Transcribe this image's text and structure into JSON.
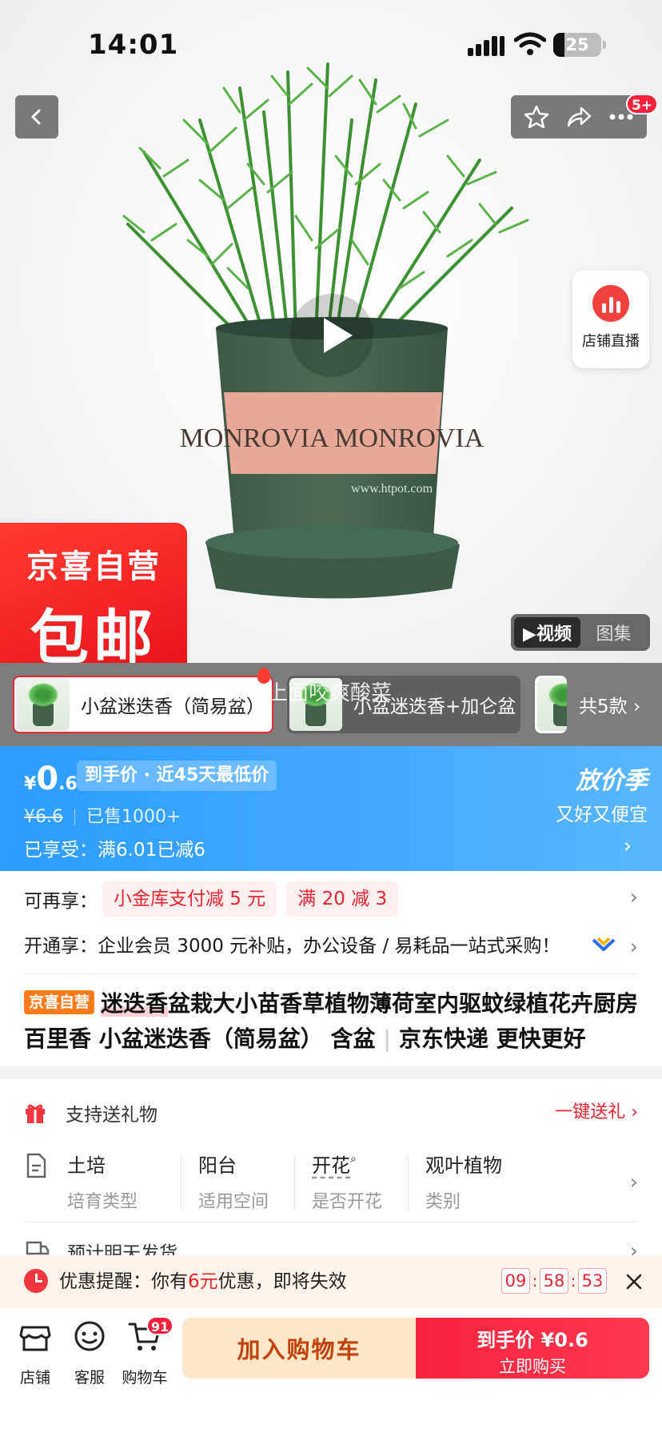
{
  "status_bar": {
    "time": "14:01",
    "battery": "25"
  },
  "hero": {
    "more_badge": "5+",
    "live_label": "店铺直播",
    "tag_line1": "京喜自营",
    "tag_line2": "包邮",
    "pot_text": "MONROVIA  MONROVIA",
    "pot_url": "www.htpot.com",
    "media_tabs": {
      "video": "▶视频",
      "gallery": "图集"
    }
  },
  "sku_strip": {
    "items": [
      {
        "label": "小盆迷迭香（简易盆）"
      },
      {
        "label": "小盆迷迭香+加仑盆"
      }
    ],
    "total": "共5款 ›",
    "danmaku": "脚一上面咬爽酸菜"
  },
  "price": {
    "currency": "¥",
    "integer": "0",
    "decimal": ".6",
    "tag": "到手价 · 近45天最低价",
    "original": "¥6.6",
    "sold": "已售1000+",
    "enjoyed": "已享受：满6.01已减6",
    "season_title": "放价季",
    "season_sub": "又好又便宜"
  },
  "info": {
    "promo_label": "可再享：",
    "promos": [
      "小金库支付减 5 元",
      "满 20 减 3"
    ],
    "vip_text": "开通享：企业会员 3000 元补贴，办公设备 / 易耗品一站式采购！",
    "title_badge": "京喜自营",
    "title_highlight": "迷迭香",
    "title_rest": "盆栽大小苗香草植物薄荷室内驱蚊绿植花卉厨房百里香 小盆迷迭香（简易盆） 含盆",
    "title_suffix": "京东快递 更快更好"
  },
  "spec": {
    "gift_label": "支持送礼物",
    "gift_cta": "一键送礼 ›",
    "attrs": [
      {
        "value": "土培",
        "key": "培育类型"
      },
      {
        "value": "阳台",
        "key": "适用空间"
      },
      {
        "value": "开花",
        "key": "是否开花"
      },
      {
        "value": "观叶植物",
        "key": "类别"
      }
    ],
    "ship": "预计明天发货"
  },
  "coupon": {
    "prefix": "优惠提醒：你有",
    "amount": "6元",
    "suffix": "优惠，即将失效",
    "timer": {
      "h": "09",
      "m": "58",
      "s": "53"
    }
  },
  "bottom": {
    "nav": {
      "shop": "店铺",
      "service": "客服",
      "cart": "购物车"
    },
    "cart_count": "91",
    "add_cart": "加入购物车",
    "buy_line1": "到手价 ¥0.6",
    "buy_line2": "立即购买"
  },
  "colors": {
    "accent_red": "#f1243a",
    "price_blue": "#2c9cff",
    "cart_orange": "#ffe7c7"
  }
}
